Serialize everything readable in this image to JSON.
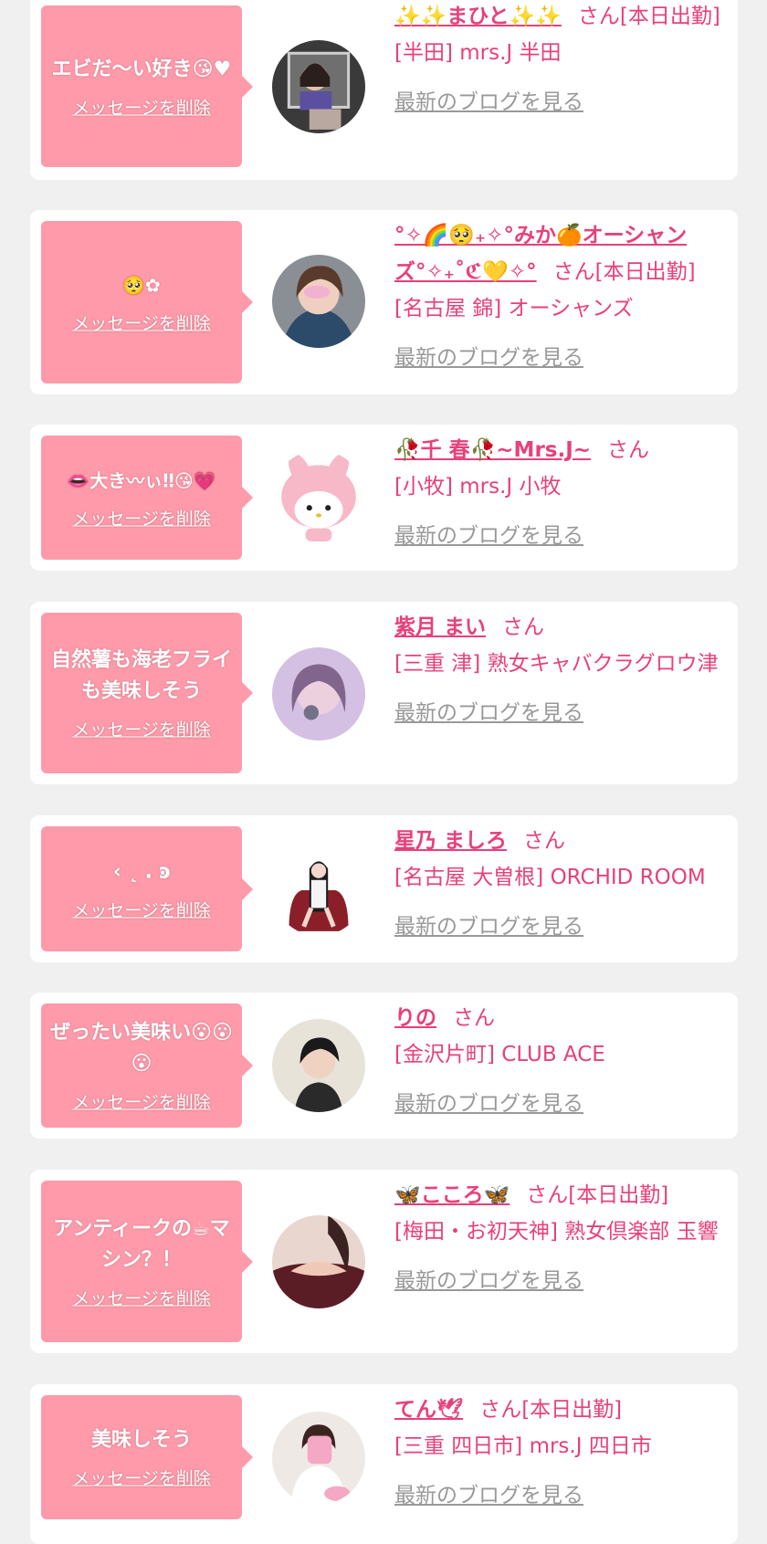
{
  "delete_label": "メッセージを削除",
  "blog_label": "最新のブログを見る",
  "colors": {
    "accent": "#e8407a",
    "bubble": "#ff9aaa",
    "muted": "#999999"
  },
  "items": [
    {
      "message": "エビだ〜い好き😘♥",
      "name": "✨✨まひと✨✨",
      "suffix": "さん[本日出勤]",
      "shop": "[半田] mrs.J 半田"
    },
    {
      "message": "🥺✿",
      "name": "°✧🌈🥺₊✧°みか🍊オーシャンズ°✧₊˚ℭ💛✧°",
      "suffix": "さん[本日出勤]",
      "shop": "[名古屋 錦] オーシャンズ"
    },
    {
      "message": "👄大き〰ぃ‼😘💗",
      "name": "🥀千 春🥀~Mrs.J~",
      "suffix": "さん",
      "shop": "[小牧] mrs.J 小牧"
    },
    {
      "message": "自然薯も海老フライも美味しそう",
      "name": "紫月 まい",
      "suffix": "さん",
      "shop": "[三重 津] 熟女キャバクラグロウ津"
    },
    {
      "message": "‹ ˛ ․ ͽ",
      "name": "星乃 ましろ",
      "suffix": "さん",
      "shop": "[名古屋 大曽根] ORCHID ROOM"
    },
    {
      "message": "ぜったい美味い😮😮😮",
      "name": "りの",
      "suffix": "さん",
      "shop": "[金沢片町] CLUB ACE"
    },
    {
      "message": "アンティークの☕マシン？！",
      "name": "🦋こころ🦋",
      "suffix": "さん[本日出勤]",
      "shop": "[梅田・お初天神] 熟女倶楽部 玉響"
    },
    {
      "message": "美味しそう",
      "name": "てん🕊",
      "suffix": "さん[本日出勤]",
      "shop": "[三重 四日市] mrs.J 四日市"
    }
  ]
}
